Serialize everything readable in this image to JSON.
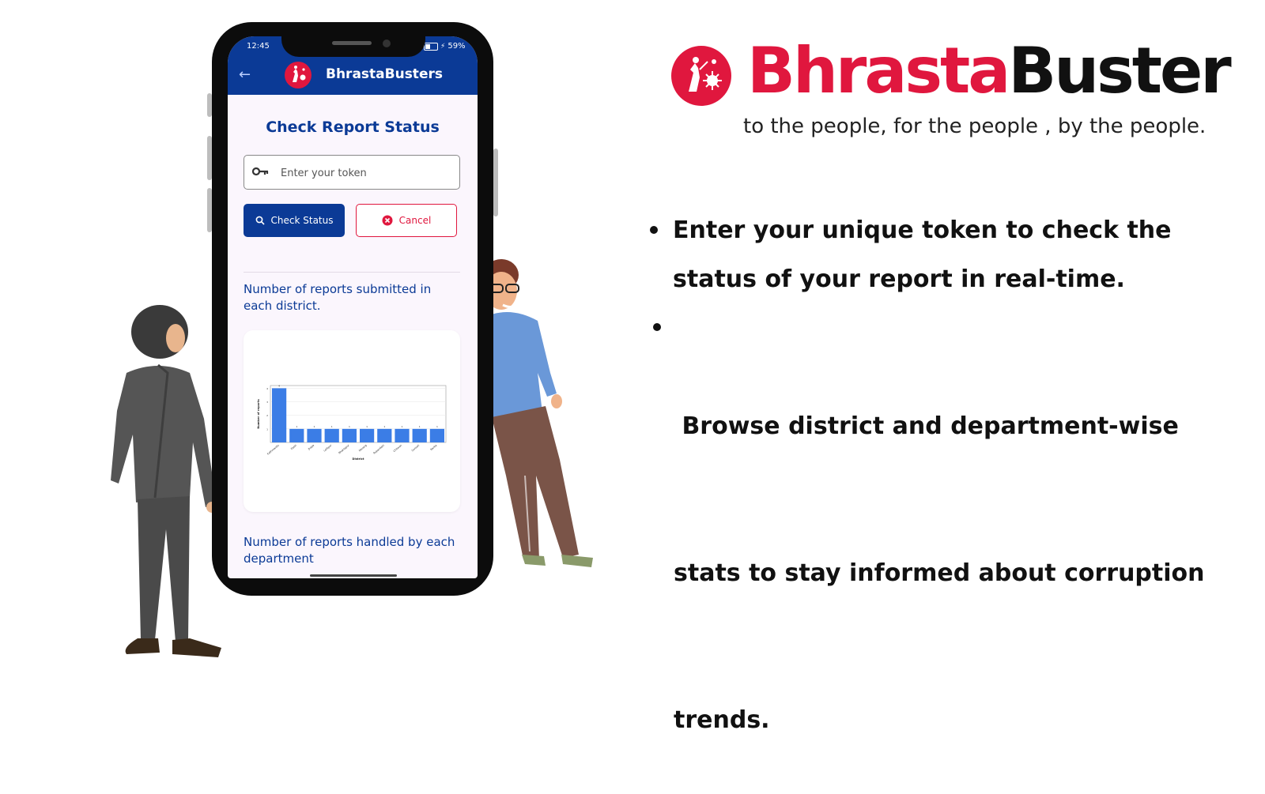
{
  "brand": {
    "name_part1": "Bhrasta",
    "name_part2": "Buster",
    "tagline": "to the people, for the people , by the people.",
    "logo_icon": "justice-emblem-icon",
    "color_red": "#e0173e",
    "color_dark": "#111111"
  },
  "features": [
    {
      "line1": "Enter your unique token to check the",
      "line2": "status of your report in real-time."
    },
    {
      "line1": " Browse district and department-wise",
      "line2": "stats to stay informed about corruption",
      "line3": "trends."
    }
  ],
  "phone": {
    "status_bar": {
      "time": "12:45",
      "battery": "59%"
    },
    "app_bar": {
      "title": "BhrastaBusters",
      "back_icon": "arrow-left-icon",
      "color": "#0b3a96"
    },
    "card_title": "Check Report Status",
    "token_input": {
      "placeholder": "Enter your token",
      "value": "",
      "icon": "key-icon"
    },
    "check_button": {
      "label": "Check Status",
      "icon": "search-icon"
    },
    "cancel_button": {
      "label": "Cancel",
      "icon": "cancel-circle-icon"
    },
    "section1_label": "Number of reports submitted in each district.",
    "section2_label": "Number of reports handled by each department"
  },
  "chart_data": {
    "type": "bar",
    "categories": [
      "Kathmandu",
      "Kaski",
      "Jhapa",
      "Lalitpur",
      "Bhaktapur",
      "Morang",
      "Rupandehi",
      "Chitwan",
      "Sunsari",
      "Banke"
    ],
    "values": [
      4,
      1,
      1,
      1,
      1,
      1,
      1,
      1,
      1,
      1
    ],
    "xlabel": "District",
    "ylabel": "Number of reports",
    "ylim": [
      0,
      4.2
    ],
    "grid": true,
    "bar_color": "#3b7de6"
  }
}
